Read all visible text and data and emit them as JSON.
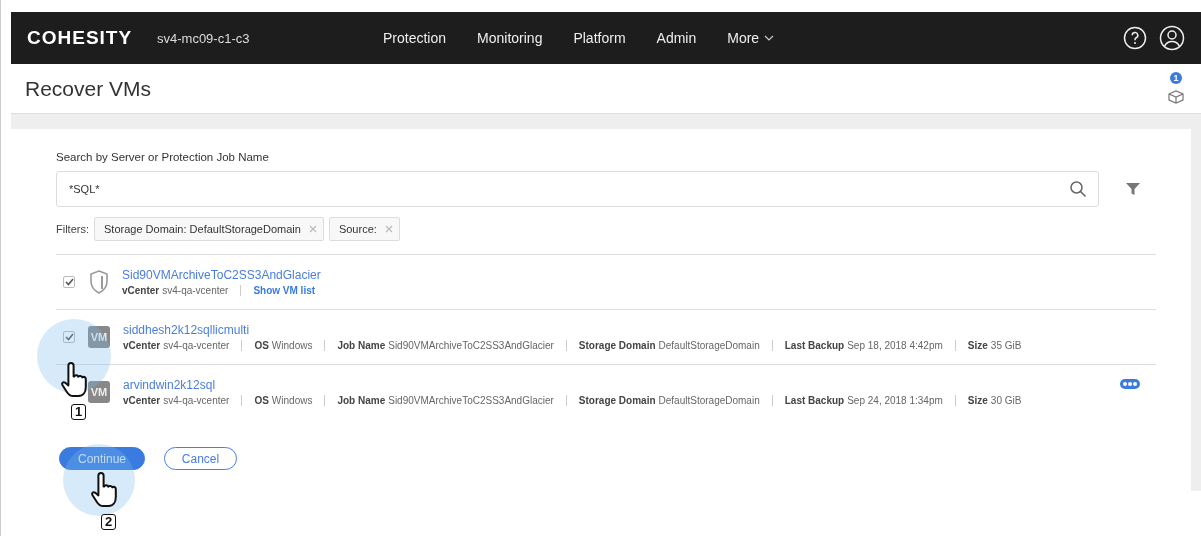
{
  "header": {
    "logo": "COHESITY",
    "cluster": "sv4-mc09-c1-c3",
    "nav": [
      {
        "label": "Protection",
        "kind": "link"
      },
      {
        "label": "Monitoring",
        "kind": "link"
      },
      {
        "label": "Platform",
        "kind": "link"
      },
      {
        "label": "Admin",
        "kind": "link"
      },
      {
        "label": "More",
        "kind": "dropdown"
      }
    ]
  },
  "page": {
    "title": "Recover VMs",
    "notification_count": "1"
  },
  "search": {
    "label": "Search by Server or Protection Job Name",
    "value": "*SQL*"
  },
  "filters": {
    "label": "Filters:",
    "chips": [
      "Storage Domain: DefaultStorageDomain",
      "Source:"
    ]
  },
  "results": [
    {
      "kind": "job",
      "name": "Sid90VMArchiveToC2SS3AndGlacier",
      "checked": true,
      "meta": [
        {
          "label": "vCenter",
          "value": "sv4-qa-vcenter"
        }
      ],
      "link": "Show VM list",
      "menu": false
    },
    {
      "kind": "vm",
      "badge": "VM",
      "name": "siddhesh2k12sqllicmulti",
      "checked": true,
      "meta": [
        {
          "label": "vCenter",
          "value": "sv4-qa-vcenter"
        },
        {
          "label": "OS",
          "value": "Windows"
        },
        {
          "label": "Job Name",
          "value": "Sid90VMArchiveToC2SS3AndGlacier"
        },
        {
          "label": "Storage Domain",
          "value": "DefaultStorageDomain"
        },
        {
          "label": "Last Backup",
          "value": "Sep 18, 2018 4:42pm"
        },
        {
          "label": "Size",
          "value": "35 GiB"
        }
      ],
      "menu": false
    },
    {
      "kind": "vm",
      "badge": "VM",
      "name": "arvindwin2k12sql",
      "meta": [
        {
          "label": "vCenter",
          "value": "sv4-qa-vcenter"
        },
        {
          "label": "OS",
          "value": "Windows"
        },
        {
          "label": "Job Name",
          "value": "Sid90VMArchiveToC2SS3AndGlacier"
        },
        {
          "label": "Storage Domain",
          "value": "DefaultStorageDomain"
        },
        {
          "label": "Last Backup",
          "value": "Sep 24, 2018 1:34pm"
        },
        {
          "label": "Size",
          "value": "30 GiB"
        }
      ],
      "menu": true
    }
  ],
  "actions": [
    {
      "label": "Continue",
      "kind": "primary"
    },
    {
      "label": "Cancel",
      "kind": "secondary"
    }
  ],
  "callouts": [
    {
      "number": "1"
    },
    {
      "number": "2"
    }
  ]
}
